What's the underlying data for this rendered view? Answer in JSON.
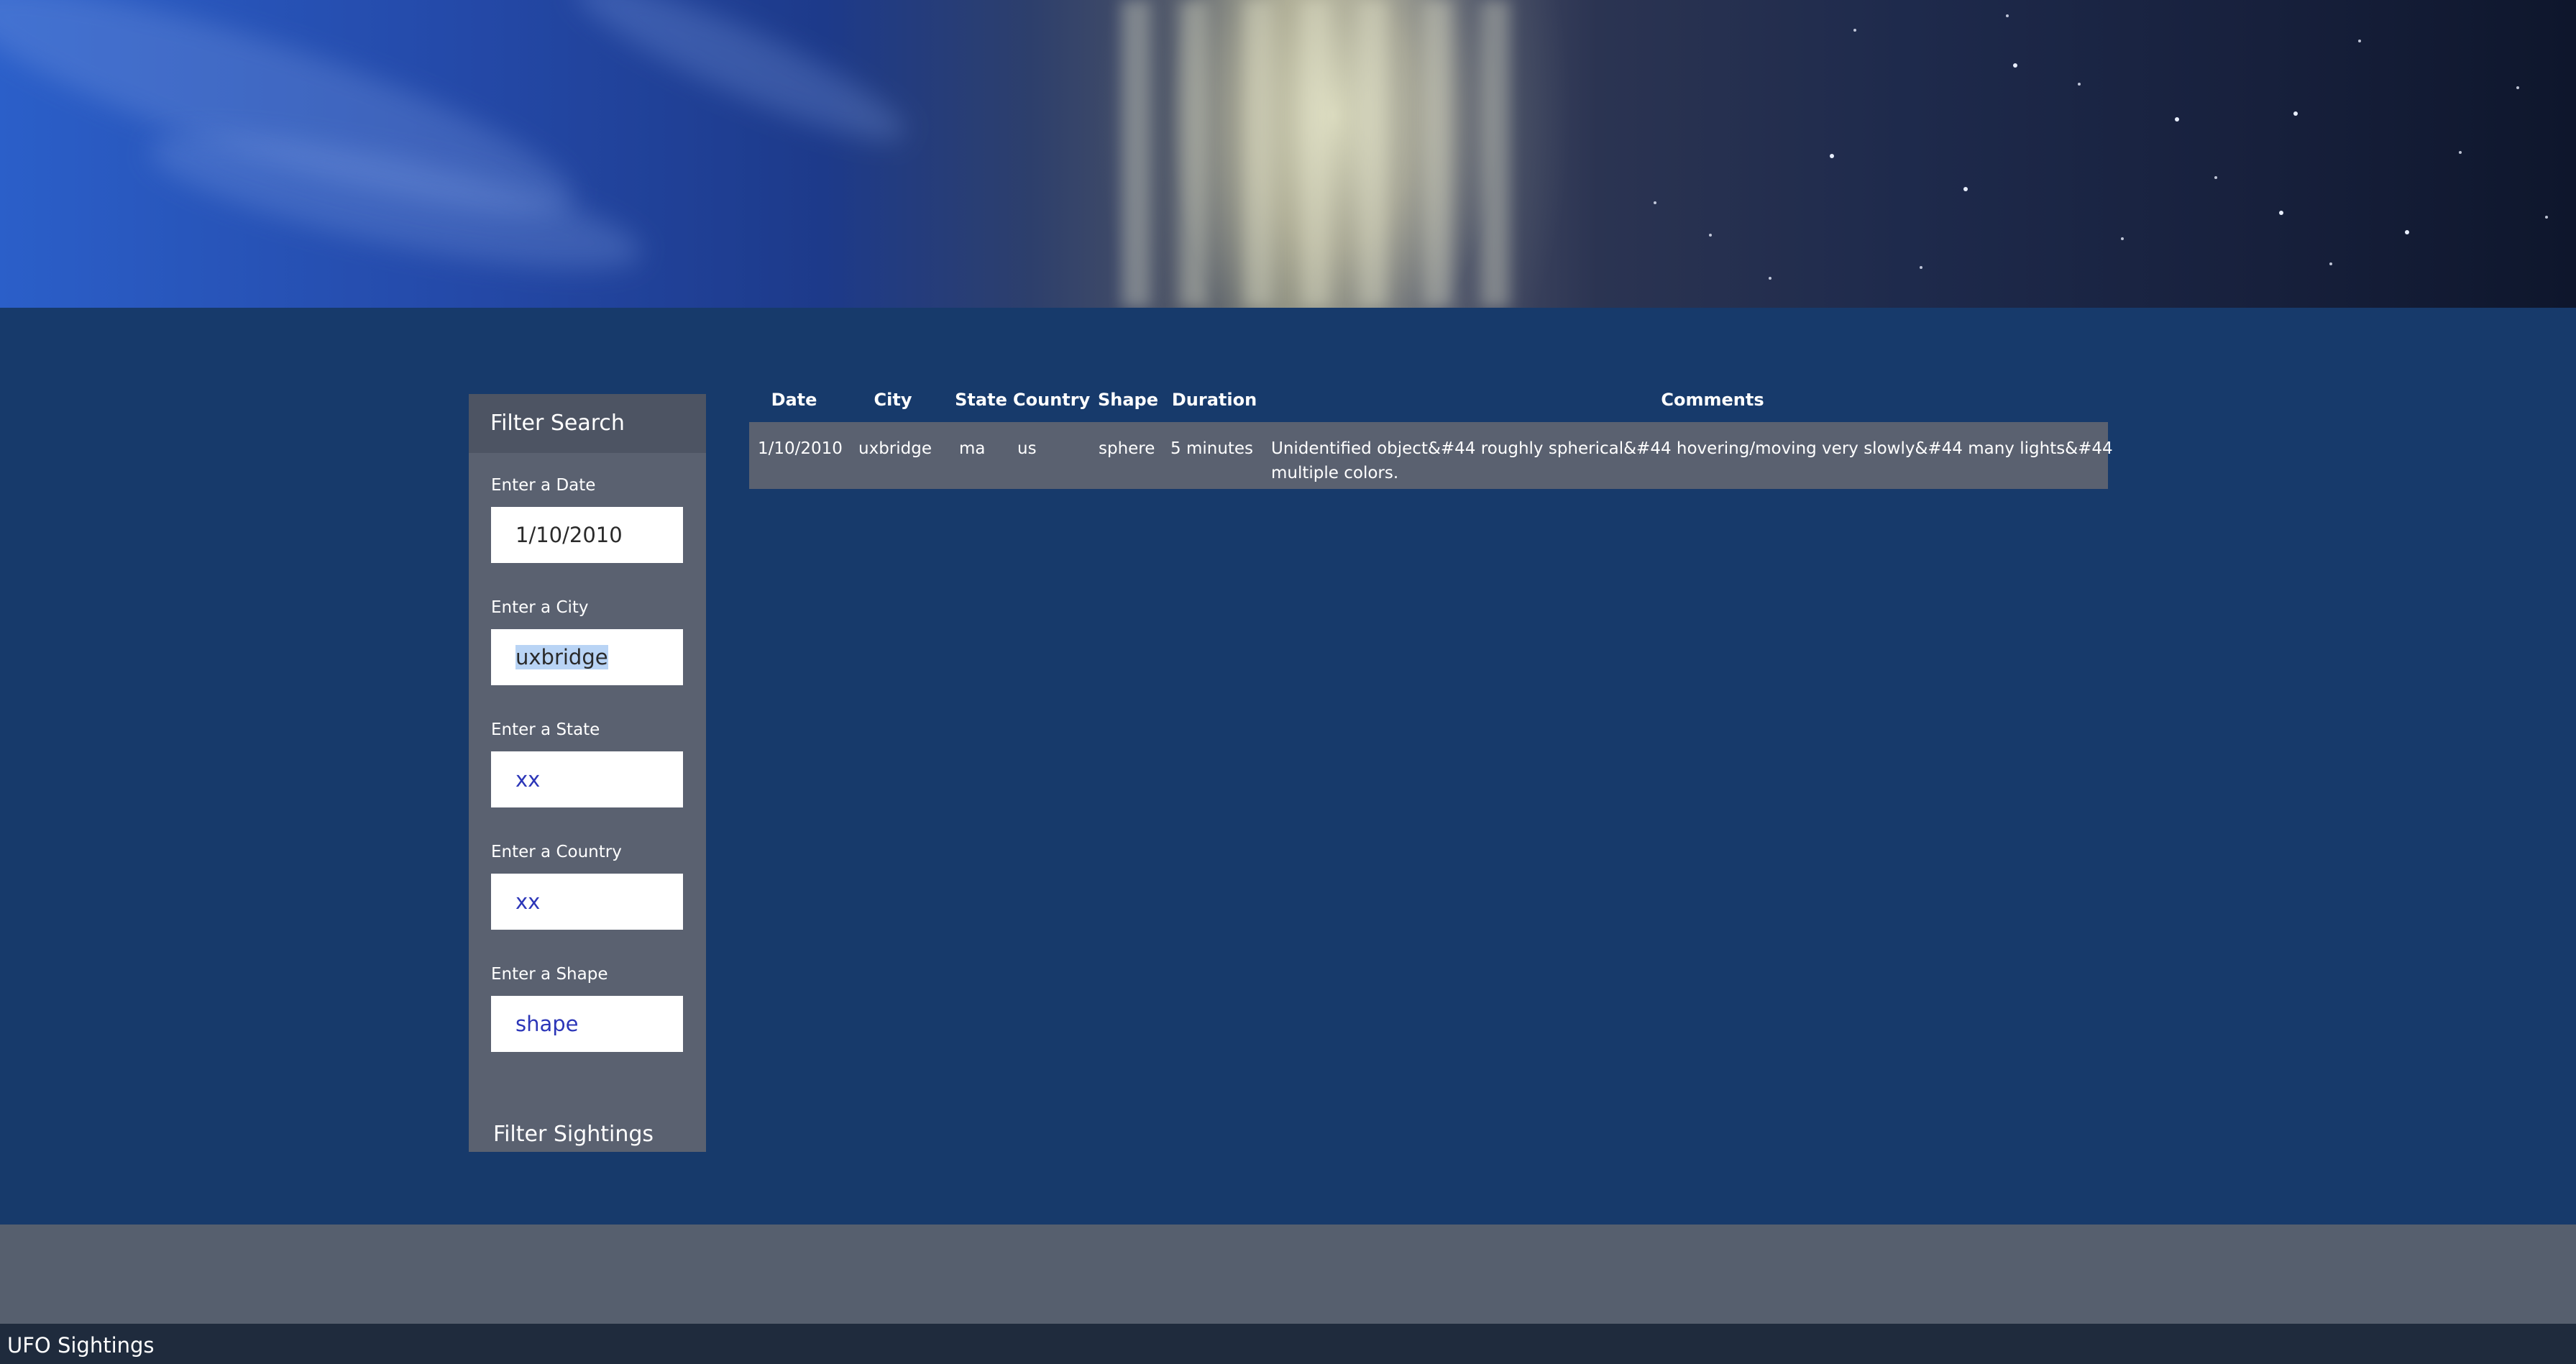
{
  "sidebar": {
    "title": "Filter Search",
    "fields": [
      {
        "label": "Enter a Date",
        "value": "1/10/2010"
      },
      {
        "label": "Enter a City",
        "value": "uxbridge"
      },
      {
        "label": "Enter a State",
        "value": "xx"
      },
      {
        "label": "Enter a Country",
        "value": "xx"
      },
      {
        "label": "Enter a Shape",
        "value": "shape"
      }
    ],
    "button": "Filter Sightings"
  },
  "table": {
    "headers": [
      "Date",
      "City",
      "State",
      "Country",
      "Shape",
      "Duration",
      "Comments"
    ],
    "rows": [
      {
        "date": "1/10/2010",
        "city": "uxbridge",
        "state": "ma",
        "country": "us",
        "shape": "sphere",
        "duration": "5 minutes",
        "comments_line1": "Unidentified object&#44 roughly spherical&#44 hovering/moving very slowly&#44 many lights&#44",
        "comments_line2": "multiple colors."
      }
    ]
  },
  "footer": {
    "title": "UFO Sightings"
  },
  "colors": {
    "page_bg": "#173a6b",
    "panel_bg": "#5a6170",
    "footer_band": "#565f6e",
    "bottom_bar": "#1f2b3d",
    "placeholder_text": "#2c36b8"
  }
}
